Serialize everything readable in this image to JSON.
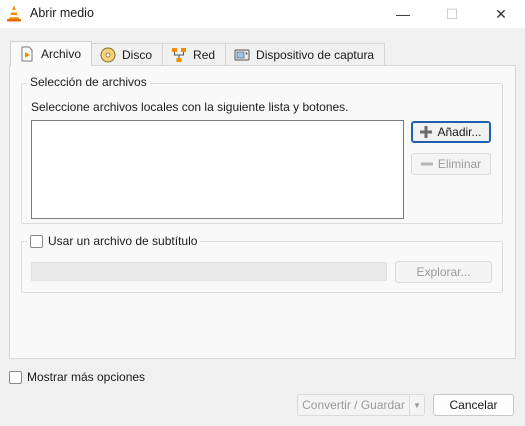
{
  "window": {
    "title": "Abrir medio",
    "minimize_glyph": "—",
    "maximize_glyph": "☐",
    "close_glyph": "✕"
  },
  "tabs": [
    {
      "label": "Archivo",
      "icon": "file-play-icon",
      "active": true
    },
    {
      "label": "Disco",
      "icon": "disc-icon",
      "active": false
    },
    {
      "label": "Red",
      "icon": "network-icon",
      "active": false
    },
    {
      "label": "Dispositivo de captura",
      "icon": "capture-device-icon",
      "active": false
    }
  ],
  "files": {
    "group_title": "Selección de archivos",
    "description": "Seleccione archivos locales con la siguiente lista y botones.",
    "add_label": "Añadir...",
    "remove_label": "Eliminar"
  },
  "subtitle": {
    "checkbox_label": "Usar un archivo de subtítulo",
    "checked": false,
    "input_value": "",
    "browse_label": "Explorar..."
  },
  "footer": {
    "more_options_label": "Mostrar más opciones",
    "more_options_checked": false,
    "convert_label": "Convertir / Guardar",
    "cancel_label": "Cancelar"
  },
  "colors": {
    "vlc_orange": "#f28c00",
    "focus_blue": "#1f5fb0"
  }
}
